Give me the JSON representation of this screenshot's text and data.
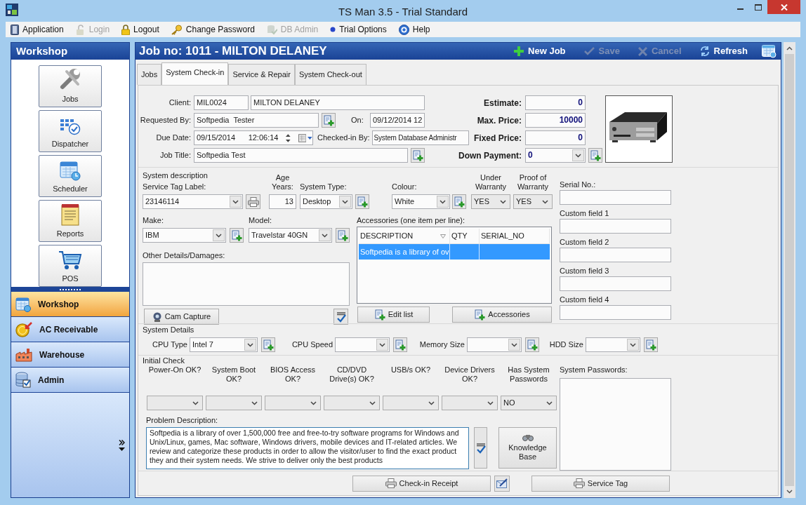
{
  "window": {
    "title": "TS Man 3.5 - Trial Standard"
  },
  "menu": [
    {
      "label": "Application",
      "disabled": false
    },
    {
      "label": "Login",
      "disabled": true
    },
    {
      "label": "Logout",
      "disabled": false
    },
    {
      "label": "Change Password",
      "disabled": false
    },
    {
      "label": "DB Admin",
      "disabled": true
    },
    {
      "label": "Trial Options",
      "disabled": false
    },
    {
      "label": "Help",
      "disabled": false
    }
  ],
  "sidebar": {
    "title": "Workshop",
    "tools": [
      {
        "label": "Jobs",
        "kind": "wrench"
      },
      {
        "label": "Dispatcher",
        "kind": "dispatcher"
      },
      {
        "label": "Scheduler",
        "kind": "calendar"
      },
      {
        "label": "Reports",
        "kind": "notepad"
      },
      {
        "label": "POS",
        "kind": "cart"
      }
    ],
    "nav": [
      {
        "label": "Workshop",
        "kind": "calendar",
        "selected": true
      },
      {
        "label": "AC Receivable",
        "kind": "coin",
        "selected": false
      },
      {
        "label": "Warehouse",
        "kind": "factory",
        "selected": false
      },
      {
        "label": "Admin",
        "kind": "database",
        "selected": false
      }
    ]
  },
  "job": {
    "title": "Job no: 1011 - MILTON DELANEY",
    "actions": [
      {
        "label": "New Job",
        "kind": "plus",
        "disabled": false
      },
      {
        "label": "Save",
        "kind": "check",
        "disabled": true
      },
      {
        "label": "Cancel",
        "kind": "cross",
        "disabled": true
      },
      {
        "label": "Refresh",
        "kind": "refresh",
        "disabled": false
      }
    ],
    "tabs": [
      {
        "label": "Jobs",
        "selected": false
      },
      {
        "label": "System Check-in",
        "selected": true
      },
      {
        "label": "Service & Repair",
        "selected": false
      },
      {
        "label": "System Check-out",
        "selected": false
      }
    ]
  },
  "checkin": {
    "client": {
      "label": "Client:",
      "code": "MIL0024",
      "name": "MILTON DELANEY"
    },
    "requested_by": {
      "label": "Requested By:",
      "value": "Softpedia  Tester"
    },
    "on": {
      "label": "On:",
      "value": "09/12/2014 12"
    },
    "due_date": {
      "label": "Due Date:",
      "date": "09/15/2014",
      "time": "12:06:14"
    },
    "checked_in_by": {
      "label": "Checked-in By:",
      "value": "System Database Administr"
    },
    "job_title": {
      "label": "Job Title:",
      "value": "Softpedia Test"
    },
    "prices": [
      {
        "label": "Estimate:",
        "value": "0",
        "kind": "field"
      },
      {
        "label": "Max. Price:",
        "value": "10000",
        "kind": "field"
      },
      {
        "label": "Fixed Price:",
        "value": "0",
        "kind": "field"
      },
      {
        "label": "Down Payment:",
        "value": "0",
        "kind": "dropdown"
      }
    ],
    "system_description": {
      "caption": "System description",
      "service_tag": {
        "label": "Service Tag Label:",
        "value": "23146114"
      },
      "age": {
        "label": "Age Years:",
        "value": "13"
      },
      "system_type": {
        "label": "System Type:",
        "value": "Desktop"
      },
      "colour": {
        "label": "Colour:",
        "value": "White"
      },
      "under_warranty": {
        "label": "Under Warranty",
        "value": "YES"
      },
      "proof_of_warranty": {
        "label": "Proof of Warranty",
        "value": "YES"
      },
      "make": {
        "label": "Make:",
        "value": "IBM"
      },
      "model": {
        "label": "Model:",
        "value": "Travelstar 40GN"
      },
      "other_details": {
        "label": "Other Details/Damages:"
      },
      "cam_capture": "Cam Capture",
      "accessories": {
        "label": "Accessories (one item per line):",
        "columns": [
          "DESCRIPTION",
          "QTY",
          "SERIAL_NO"
        ],
        "rows": [
          {
            "description": "Softpedia is a library of ov",
            "selected": true
          }
        ],
        "edit_button": "Edit list",
        "accessories_button": "Accessories"
      },
      "custom_fields": [
        {
          "label": "Serial No.:"
        },
        {
          "label": "Custom field 1"
        },
        {
          "label": "Custom field 2"
        },
        {
          "label": "Custom field 3"
        },
        {
          "label": "Custom field 4"
        }
      ]
    },
    "system_details": {
      "caption": "System Details",
      "fields": [
        {
          "label": "CPU Type",
          "value": "Intel 7"
        },
        {
          "label": "CPU Speed"
        },
        {
          "label": "Memory Size"
        },
        {
          "label": "HDD Size"
        }
      ]
    },
    "initial_check": {
      "caption": "Initial Check",
      "checks": [
        {
          "label": "Power-On OK?"
        },
        {
          "label": "System Boot OK?"
        },
        {
          "label": "BIOS Access OK?"
        },
        {
          "label": "CD/DVD Drive(s) OK?"
        },
        {
          "label": "USB/s OK?"
        },
        {
          "label": "Device Drivers OK?"
        },
        {
          "label": "Has System Passwords",
          "value": "NO"
        }
      ],
      "problem": {
        "label": "Problem Description:",
        "value": "Softpedia is a library of over 1,500,000 free and free-to-try software programs for Windows and Unix/Linux, games,  Mac software, Windows drivers, mobile devices and IT-related articles. We review and categorize these products in order to allow the visitor/user to find the exact product they and  their system needs.  We strive to deliver only the best products"
      },
      "knowledge_base": "Knowledge Base",
      "passwords": {
        "label": "System Passwords:"
      }
    },
    "footer": {
      "receipt_button": "Check-in Receipt",
      "service_tag_button": "Service Tag"
    }
  }
}
